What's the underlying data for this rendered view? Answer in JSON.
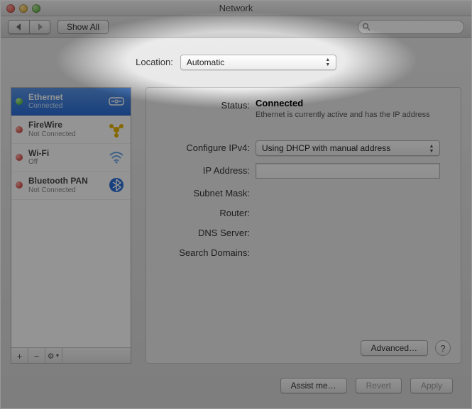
{
  "window_title": "Network",
  "toolbar": {
    "show_all": "Show All"
  },
  "search": {
    "placeholder": ""
  },
  "location": {
    "label": "Location:",
    "selected": "Automatic"
  },
  "sidebar": {
    "items": [
      {
        "name": "Ethernet",
        "sub": "Connected",
        "status": "green",
        "icon": "ethernet-icon"
      },
      {
        "name": "FireWire",
        "sub": "Not Connected",
        "status": "red",
        "icon": "firewire-icon"
      },
      {
        "name": "Wi-Fi",
        "sub": "Off",
        "status": "red",
        "icon": "wifi-icon"
      },
      {
        "name": "Bluetooth PAN",
        "sub": "Not Connected",
        "status": "red",
        "icon": "bluetooth-icon"
      }
    ],
    "add": "+",
    "remove": "−",
    "gear": "⚙▾"
  },
  "detail": {
    "status_label": "Status:",
    "status_value": "Connected",
    "status_desc": "Ethernet is currently active and has the IP address",
    "configure_label": "Configure IPv4:",
    "configure_value": "Using DHCP with manual address",
    "ip_label": "IP Address:",
    "ip_value": "",
    "subnet_label": "Subnet Mask:",
    "router_label": "Router:",
    "dns_label": "DNS Server:",
    "search_domains_label": "Search Domains:",
    "advanced": "Advanced…",
    "help": "?"
  },
  "footer": {
    "assist": "Assist me…",
    "revert": "Revert",
    "apply": "Apply"
  }
}
